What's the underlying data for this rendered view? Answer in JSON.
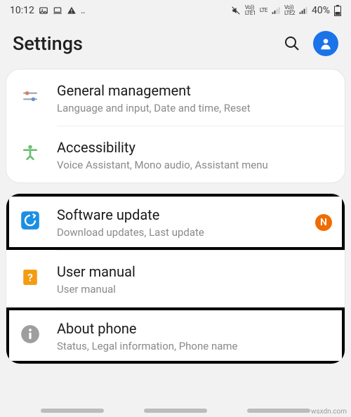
{
  "statusbar": {
    "time": "10:12",
    "sim1": "Vo)) LTE LTE1",
    "sim2": "Vo)) LTE2",
    "battery": "40%"
  },
  "header": {
    "title": "Settings"
  },
  "group1": {
    "items": [
      {
        "icon": "sliders-icon",
        "title": "General management",
        "sub": "Language and input, Date and time, Reset"
      },
      {
        "icon": "accessibility-icon",
        "title": "Accessibility",
        "sub": "Voice Assistant, Mono audio, Assistant menu"
      }
    ]
  },
  "group2": {
    "items": [
      {
        "icon": "update-icon",
        "title": "Software update",
        "sub": "Download updates, Last update",
        "badge": "N",
        "highlight": true
      },
      {
        "icon": "manual-icon",
        "title": "User manual",
        "sub": "User manual"
      },
      {
        "icon": "about-icon",
        "title": "About phone",
        "sub": "Status, Legal information, Phone name",
        "highlight": true
      }
    ]
  },
  "watermark": "wsxdn.com"
}
